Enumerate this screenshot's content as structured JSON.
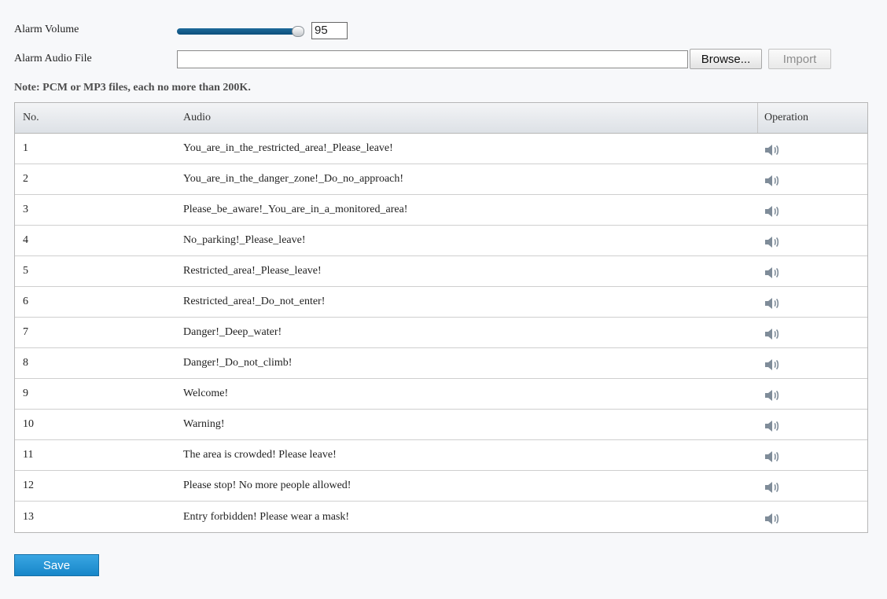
{
  "form": {
    "alarm_volume_label": "Alarm Volume",
    "alarm_volume_value": "95",
    "alarm_volume_level": 95,
    "alarm_audio_file_label": "Alarm Audio File",
    "alarm_audio_file_value": "",
    "browse_label": "Browse...",
    "import_label": "Import",
    "note": "Note: PCM or MP3 files, each no more than 200K."
  },
  "table": {
    "headers": {
      "no": "No.",
      "audio": "Audio",
      "operation": "Operation"
    },
    "rows": [
      {
        "no": "1",
        "audio": "You_are_in_the_restricted_area!_Please_leave!"
      },
      {
        "no": "2",
        "audio": "You_are_in_the_danger_zone!_Do_no_approach!"
      },
      {
        "no": "3",
        "audio": "Please_be_aware!_You_are_in_a_monitored_area!"
      },
      {
        "no": "4",
        "audio": "No_parking!_Please_leave!"
      },
      {
        "no": "5",
        "audio": "Restricted_area!_Please_leave!"
      },
      {
        "no": "6",
        "audio": "Restricted_area!_Do_not_enter!"
      },
      {
        "no": "7",
        "audio": "Danger!_Deep_water!"
      },
      {
        "no": "8",
        "audio": "Danger!_Do_not_climb!"
      },
      {
        "no": "9",
        "audio": "Welcome!"
      },
      {
        "no": "10",
        "audio": "Warning!"
      },
      {
        "no": "11",
        "audio": "The area is crowded! Please leave!"
      },
      {
        "no": "12",
        "audio": "Please stop! No more people allowed!"
      },
      {
        "no": "13",
        "audio": "Entry forbidden! Please wear a mask!"
      }
    ],
    "operation_icon": "speaker-play-icon"
  },
  "footer": {
    "save_label": "Save"
  },
  "colors": {
    "slider_track": "#0c4f7c",
    "save_button": "#2196d9",
    "disabled_text": "#8d8d8d"
  }
}
